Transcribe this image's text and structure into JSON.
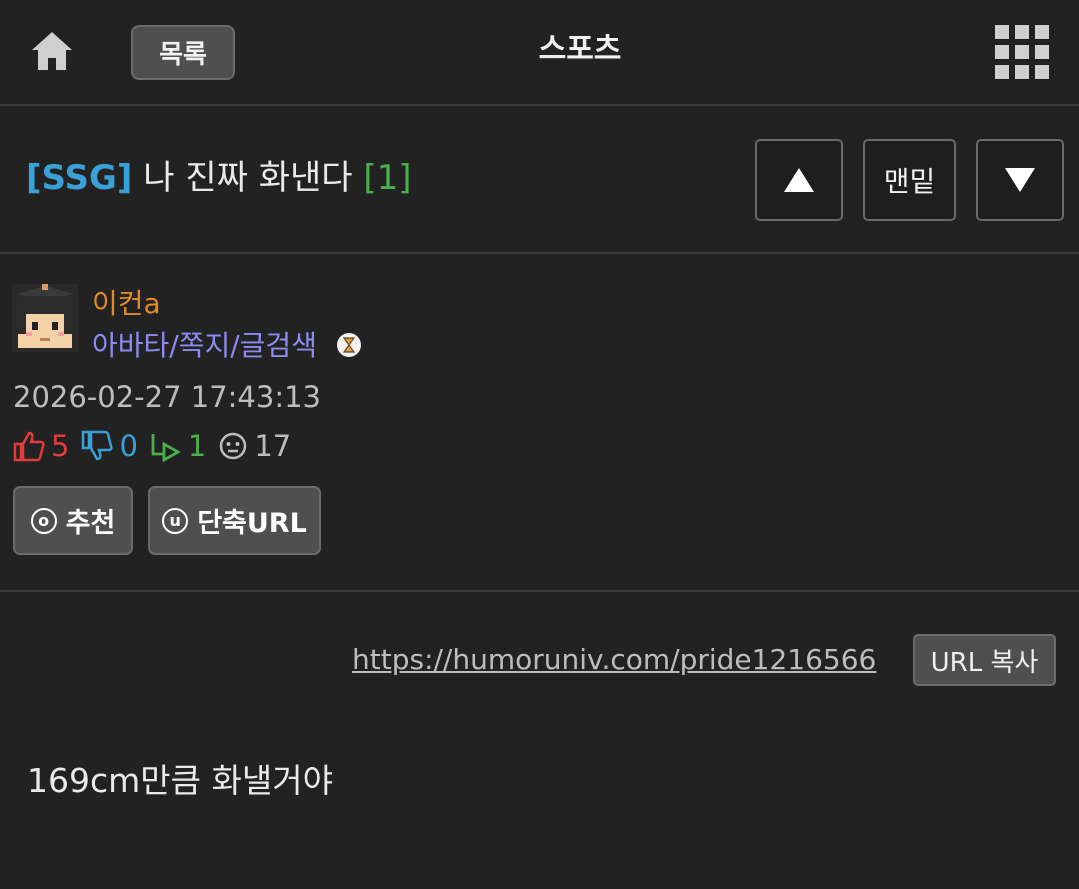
{
  "header": {
    "list_label": "목록",
    "board_name": "스포츠"
  },
  "post": {
    "category": "[SSG]",
    "title": "나 진짜 화낸다",
    "comment_count": "[1]",
    "nav": {
      "bottom_label": "맨밑"
    },
    "author": {
      "nickname": "이컨a",
      "links": "아바타/쪽지/글검색"
    },
    "date": "2026-02-27 17:43:13",
    "stats": {
      "upvotes": "5",
      "downvotes": "0",
      "shares": "1",
      "views": "17"
    },
    "actions": {
      "recommend_label": "추천",
      "recommend_icon_letter": "o",
      "shorturl_label": "단축URL",
      "shorturl_icon_letter": "u"
    },
    "url": "https://humoruniv.com/pride1216566",
    "url_copy_label": "URL 복사",
    "body": "169cm만큼 화낼거야"
  },
  "icons": {
    "home": "home-icon",
    "grid": "grid-menu-icon",
    "up": "triangle-up-icon",
    "down": "triangle-down-icon",
    "thumbs_up": "thumbs-up-icon",
    "thumbs_down": "thumbs-down-icon",
    "share": "share-arrow-icon",
    "views": "face-icon",
    "badge": "hourglass-badge-icon"
  },
  "colors": {
    "background": "#222222",
    "category": "#3aa0d8",
    "comment_count": "#4cae4c",
    "nickname": "#e08a2a",
    "user_links": "#8c8cf0",
    "upvote": "#e23b3b",
    "downvote": "#3aa0d8",
    "share": "#4cae4c"
  }
}
